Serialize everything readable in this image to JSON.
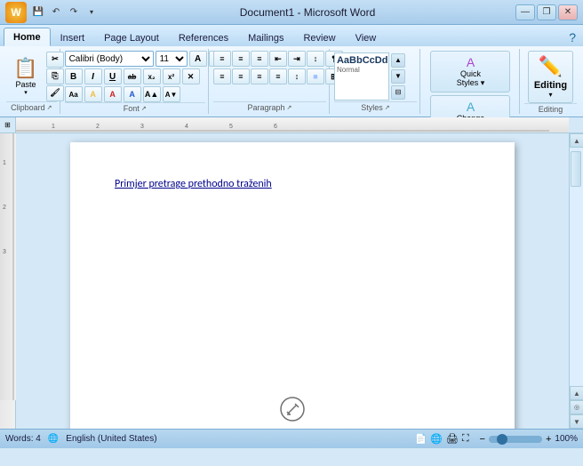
{
  "titleBar": {
    "title": "Document1 - Microsoft Word",
    "minimizeLabel": "—",
    "restoreLabel": "❐",
    "closeLabel": "✕"
  },
  "quickAccess": {
    "saveLabel": "💾",
    "undoLabel": "↶",
    "redoLabel": "↷",
    "dropLabel": "▾"
  },
  "ribbon": {
    "tabs": [
      {
        "id": "home",
        "label": "Home",
        "active": true
      },
      {
        "id": "insert",
        "label": "Insert",
        "active": false
      },
      {
        "id": "pagelayout",
        "label": "Page Layout",
        "active": false
      },
      {
        "id": "references",
        "label": "References",
        "active": false
      },
      {
        "id": "mailings",
        "label": "Mailings",
        "active": false
      },
      {
        "id": "review",
        "label": "Review",
        "active": false
      },
      {
        "id": "view",
        "label": "View",
        "active": false
      }
    ],
    "groups": {
      "clipboard": {
        "label": "Clipboard",
        "paste": "Paste",
        "cut": "✂",
        "copy": "⎘",
        "formatPainter": "🖌"
      },
      "font": {
        "label": "Font",
        "fontName": "Calibri (Body)",
        "fontSize": "11",
        "bold": "B",
        "italic": "I",
        "underline": "U",
        "strikethrough": "ab",
        "subscript": "x₂",
        "superscript": "x²",
        "clearFormatting": "A",
        "textHighlight": "A",
        "fontColor": "A",
        "grow": "A▲",
        "shrink": "A▼",
        "changeCase": "Aa"
      },
      "paragraph": {
        "label": "Paragraph",
        "bullets": "≡",
        "numbering": "≡",
        "multilevel": "≡",
        "decreaseIndent": "⇤",
        "increaseIndent": "⇥",
        "sortText": "↕",
        "showParagraph": "¶",
        "alignLeft": "≡",
        "alignCenter": "≡",
        "alignRight": "≡",
        "justify": "≡",
        "lineSpacing": "↕",
        "shadingColor": "■",
        "borders": "⊞"
      },
      "styles": {
        "label": "Styles",
        "quickStylesLabel": "Quick\nStyles ▾",
        "changeStylesLabel": "Change\nStyles ▾"
      },
      "editing": {
        "label": "Editing",
        "editingLabel": "Editing",
        "dropArrow": "▾"
      }
    }
  },
  "document": {
    "content": "Primjer pretrage prethodno traženih"
  },
  "statusBar": {
    "words": "Words: 4",
    "language": "English (United States)",
    "zoom": "100%",
    "zoomValue": 100
  },
  "ruler": {
    "numbers": [
      "1",
      "2",
      "3",
      "4",
      "5",
      "6"
    ]
  }
}
